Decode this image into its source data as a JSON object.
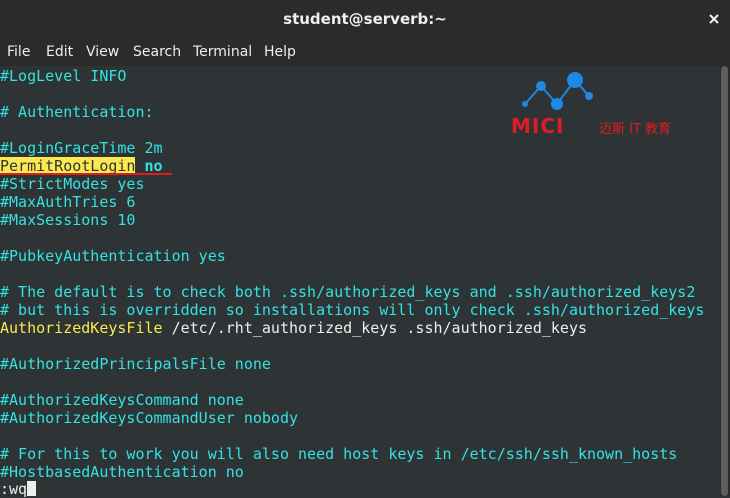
{
  "window": {
    "title": "student@serverb:~"
  },
  "menu": [
    "File",
    "Edit",
    "View",
    "Search",
    "Terminal",
    "Help"
  ],
  "logo": {
    "brand": "MICI",
    "tagline": "迈斯 IT 教育"
  },
  "terminal": {
    "lines": [
      "#LogLevel INFO",
      "",
      "# Authentication:",
      "",
      "#LoginGraceTime 2m",
      "",
      "#StrictModes yes",
      "#MaxAuthTries 6",
      "#MaxSessions 10",
      "",
      "#PubkeyAuthentication yes",
      "",
      "# The default is to check both .ssh/authorized_keys and .ssh/authorized_keys2",
      "# but this is overridden so installations will only check .ssh/authorized_keys",
      "",
      "",
      "#AuthorizedPrincipalsFile none",
      "",
      "#AuthorizedKeysCommand none",
      "#AuthorizedKeysCommandUser nobody",
      "",
      "# For this to work you will also need host keys in /etc/ssh/ssh_known_hosts",
      "#HostbasedAuthentication no"
    ],
    "permit_key": "PermitRootLogin",
    "permit_value": "no",
    "authkeys_key": "AuthorizedKeysFile",
    "authkeys_value": " /etc/.rht_authorized_keys .ssh/authorized_keys",
    "command_line": ":wq"
  }
}
